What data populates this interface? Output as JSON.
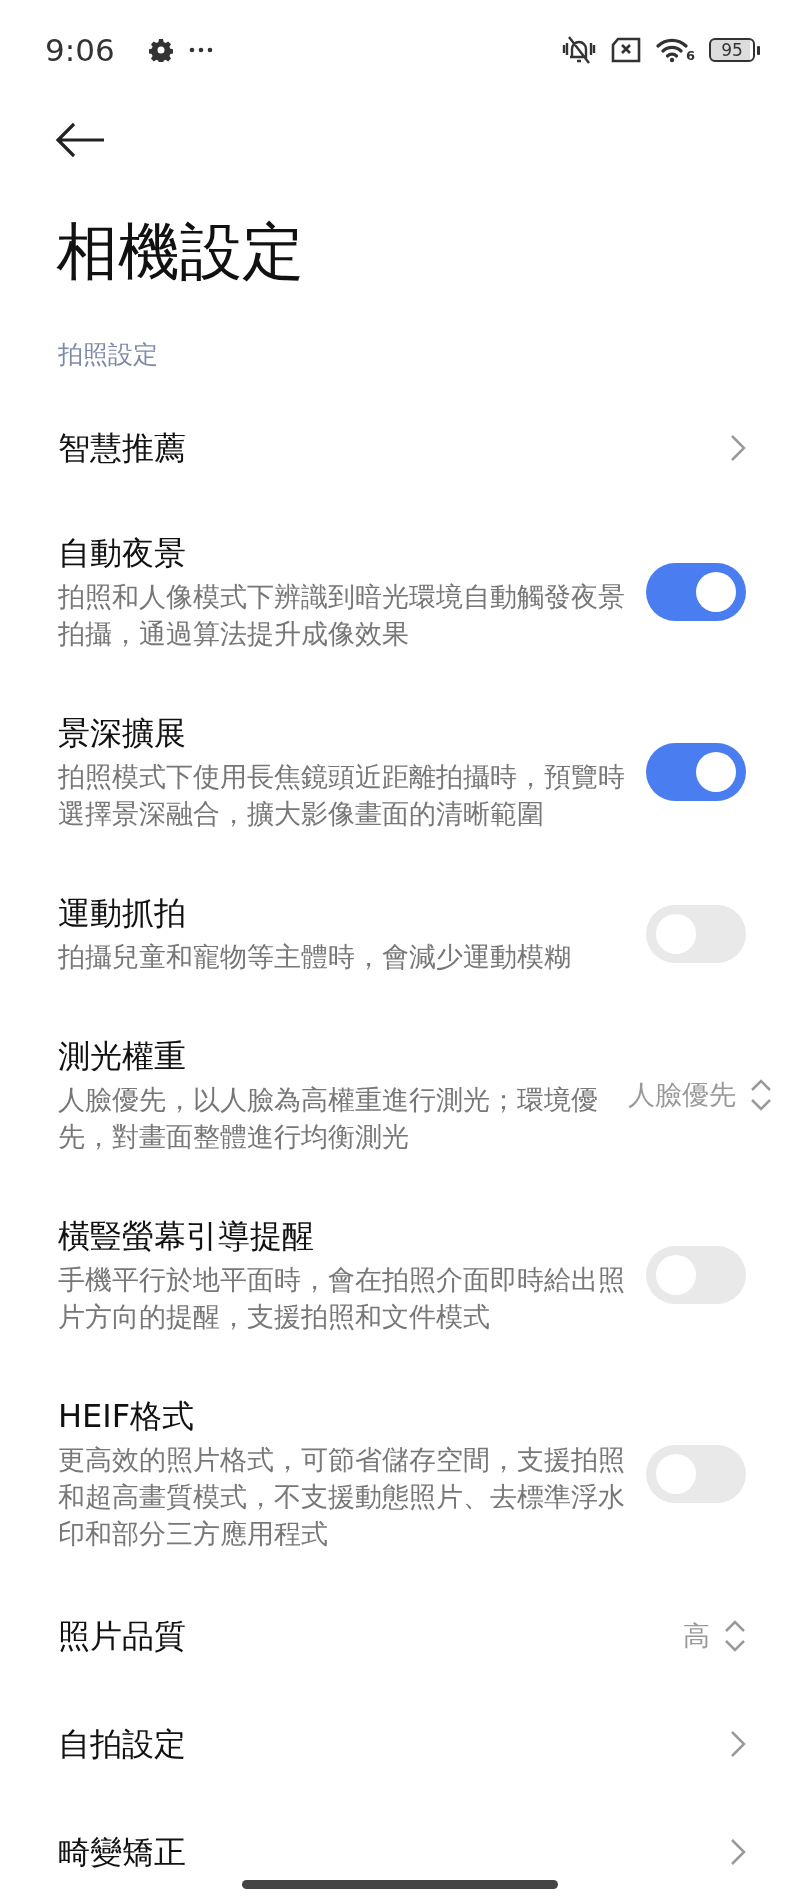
{
  "status_bar": {
    "time": "9:06",
    "wifi_standard": "6",
    "battery": "95"
  },
  "title": "相機設定",
  "section": {
    "header": "拍照設定",
    "items": [
      {
        "kind": "link",
        "title": "智慧推薦"
      },
      {
        "kind": "toggle",
        "title": "自動夜景",
        "description": "拍照和人像模式下辨識到暗光環境自動觸發夜景拍攝，通過算法提升成像效果",
        "on": true
      },
      {
        "kind": "toggle",
        "title": "景深擴展",
        "description": "拍照模式下使用長焦鏡頭近距離拍攝時，預覽時選擇景深融合，擴大影像畫面的清晰範圍",
        "on": true
      },
      {
        "kind": "toggle",
        "title": "運動抓拍",
        "description": "拍攝兒童和寵物等主體時，會減少運動模糊",
        "on": false
      },
      {
        "kind": "select",
        "title": "測光權重",
        "description": "人臉優先，以人臉為高權重進行測光；環境優先，對畫面整體進行均衡測光",
        "value": "人臉優先"
      },
      {
        "kind": "toggle",
        "title": "橫豎螢幕引導提醒",
        "description": "手機平行於地平面時，會在拍照介面即時給出照片方向的提醒，支援拍照和文件模式",
        "on": false
      },
      {
        "kind": "toggle",
        "title": "HEIF格式",
        "description": "更高效的照片格式，可節省儲存空間，支援拍照和超高畫質模式，不支援動態照片、去標準浮水印和部分三方應用程式",
        "on": false
      },
      {
        "kind": "select",
        "title": "照片品質",
        "value": "高"
      },
      {
        "kind": "link",
        "title": "自拍設定"
      },
      {
        "kind": "link",
        "title": "畸變矯正"
      }
    ]
  }
}
